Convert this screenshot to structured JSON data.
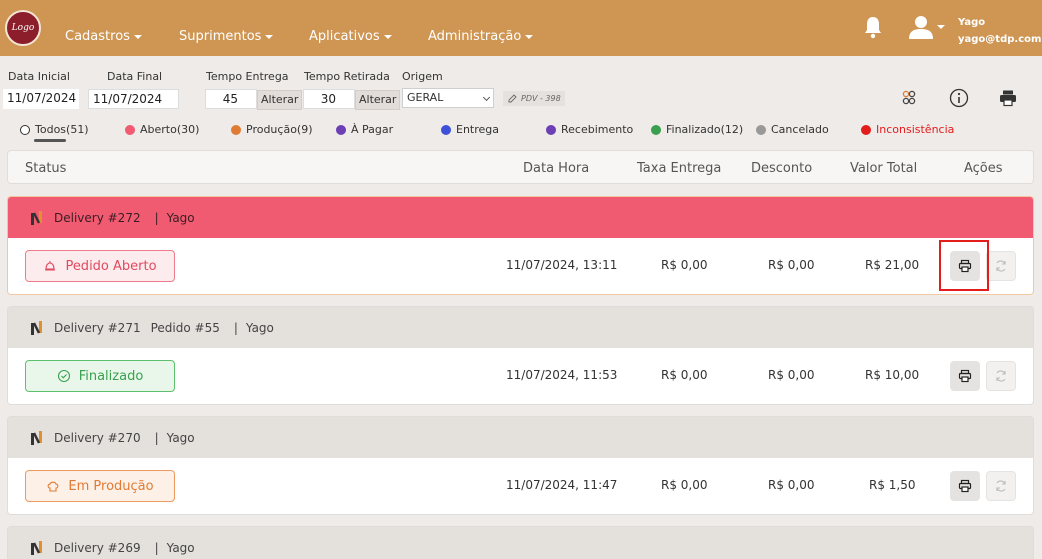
{
  "nav": {
    "logo_text": "Logo",
    "items": [
      "Cadastros",
      "Suprimentos",
      "Aplicativos",
      "Administração"
    ],
    "user_name": "Yago",
    "user_email": "yago@tdp.com.br"
  },
  "filters": {
    "data_inicial_label": "Data Inicial",
    "data_inicial_value": "11/07/2024",
    "data_final_label": "Data Final",
    "data_final_value": "11/07/2024",
    "tempo_entrega_label": "Tempo Entrega",
    "tempo_entrega_value": "45",
    "tempo_retirada_label": "Tempo Retirada",
    "tempo_retirada_value": "30",
    "alterar_label": "Alterar",
    "origem_label": "Origem",
    "origem_value": "GERAL",
    "pdv_label": "PDV - 398"
  },
  "status_filters": [
    {
      "label": "Todos(51)",
      "color": "#ffffff"
    },
    {
      "label": "Aberto(30)",
      "color": "#f15b72"
    },
    {
      "label": "Produção(9)",
      "color": "#e07b34"
    },
    {
      "label": "À Pagar",
      "color": "#6c3fb5"
    },
    {
      "label": "Entrega",
      "color": "#3f51d9"
    },
    {
      "label": "Recebimento",
      "color": "#6c3fb5"
    },
    {
      "label": "Finalizado(12)",
      "color": "#3aa04f"
    },
    {
      "label": "Cancelado",
      "color": "#999999"
    },
    {
      "label": "Inconsistência",
      "color": "#e31c1c"
    }
  ],
  "table": {
    "headers": [
      "Status",
      "Data Hora",
      "Taxa Entrega",
      "Desconto",
      "Valor Total",
      "Ações"
    ]
  },
  "orders": [
    {
      "title": "Delivery #272",
      "pedido": "",
      "user": "Yago",
      "status": "Pedido Aberto",
      "datetime": "11/07/2024, 13:11",
      "taxa": "R$ 0,00",
      "desconto": "R$ 0,00",
      "total": "R$ 21,00"
    },
    {
      "title": "Delivery #271",
      "pedido": "Pedido #55",
      "user": "Yago",
      "status": "Finalizado",
      "datetime": "11/07/2024, 11:53",
      "taxa": "R$ 0,00",
      "desconto": "R$ 0,00",
      "total": "R$ 10,00"
    },
    {
      "title": "Delivery #270",
      "pedido": "",
      "user": "Yago",
      "status": "Em Produção",
      "datetime": "11/07/2024, 11:47",
      "taxa": "R$ 0,00",
      "desconto": "R$ 0,00",
      "total": "R$ 1,50"
    },
    {
      "title": "Delivery #269",
      "pedido": "",
      "user": "Yago"
    }
  ],
  "separator": "|"
}
